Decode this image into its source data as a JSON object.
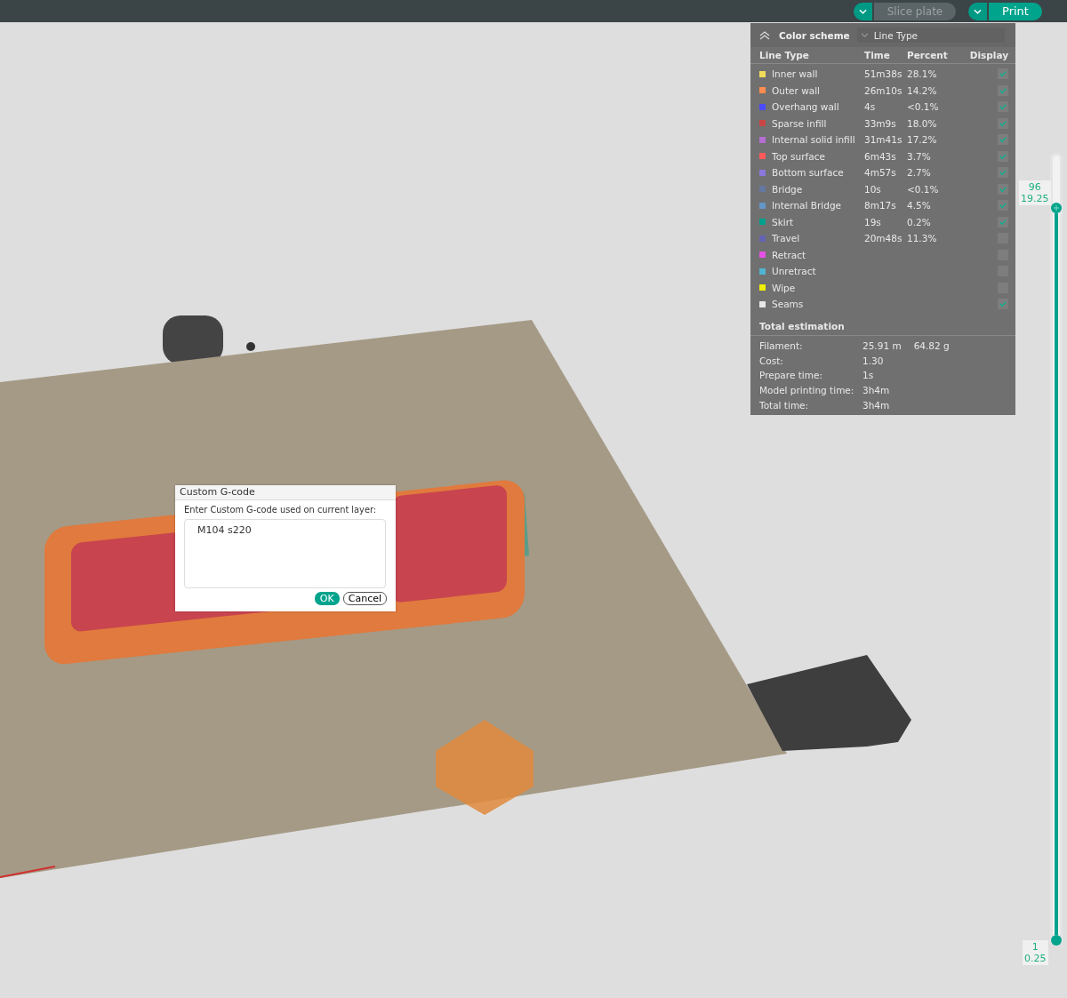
{
  "toolbar": {
    "slice_button": {
      "label": "Slice plate",
      "disabled": true
    },
    "print_button": {
      "label": "Print"
    }
  },
  "legend": {
    "title": "Color scheme",
    "scheme": "Line Type",
    "expanded": true,
    "columns": [
      "Line Type",
      "Time",
      "Percent",
      "Display"
    ],
    "rows": [
      {
        "name": "Inner wall",
        "time": "51m38s",
        "percent": "28.1%",
        "color": "#f0dc5a",
        "checked": true
      },
      {
        "name": "Outer wall",
        "time": "26m10s",
        "percent": "14.2%",
        "color": "#ff8c50",
        "checked": true
      },
      {
        "name": "Overhang wall",
        "time": "4s",
        "percent": "<0.1%",
        "color": "#4b4bff",
        "checked": true
      },
      {
        "name": "Sparse infill",
        "time": "33m9s",
        "percent": "18.0%",
        "color": "#c84646",
        "checked": true
      },
      {
        "name": "Internal solid infill",
        "time": "31m41s",
        "percent": "17.2%",
        "color": "#b46ed2",
        "checked": true
      },
      {
        "name": "Top surface",
        "time": "6m43s",
        "percent": "3.7%",
        "color": "#ff5a5a",
        "checked": true
      },
      {
        "name": "Bottom surface",
        "time": "4m57s",
        "percent": "2.7%",
        "color": "#8c78dc",
        "checked": true
      },
      {
        "name": "Bridge",
        "time": "10s",
        "percent": "<0.1%",
        "color": "#6478a0",
        "checked": true
      },
      {
        "name": "Internal Bridge",
        "time": "8m17s",
        "percent": "4.5%",
        "color": "#6496c8",
        "checked": true
      },
      {
        "name": "Skirt",
        "time": "19s",
        "percent": "0.2%",
        "color": "#00a08c",
        "checked": true
      },
      {
        "name": "Travel",
        "time": "20m48s",
        "percent": "11.3%",
        "color": "#6464b4",
        "checked": false
      },
      {
        "name": "Retract",
        "time": "",
        "percent": "",
        "color": "#e650e6",
        "checked": false
      },
      {
        "name": "Unretract",
        "time": "",
        "percent": "",
        "color": "#50b4d2",
        "checked": false
      },
      {
        "name": "Wipe",
        "time": "",
        "percent": "",
        "color": "#f0f000",
        "checked": false
      },
      {
        "name": "Seams",
        "time": "",
        "percent": "",
        "color": "#e6e6e6",
        "checked": true
      }
    ],
    "total_title": "Total estimation",
    "totals": [
      {
        "label": "Filament:",
        "values": [
          "25.91 m",
          "64.82 g"
        ]
      },
      {
        "label": "Cost:",
        "values": [
          "1.30"
        ]
      },
      {
        "label": "Prepare time:",
        "values": [
          "1s"
        ]
      },
      {
        "label": "Model printing time:",
        "values": [
          "3h4m"
        ]
      },
      {
        "label": "Total time:",
        "values": [
          "3h4m"
        ]
      }
    ]
  },
  "dialog": {
    "title": "Custom G-code",
    "prompt": "Enter Custom G-code used on current layer:",
    "value": "M104 s220",
    "buttons": [
      "OK",
      "Cancel"
    ]
  },
  "layer_slider": {
    "level": 0.93,
    "top_label": [
      "96",
      "19.25"
    ],
    "bottom_label": [
      "1",
      "0.25"
    ]
  }
}
